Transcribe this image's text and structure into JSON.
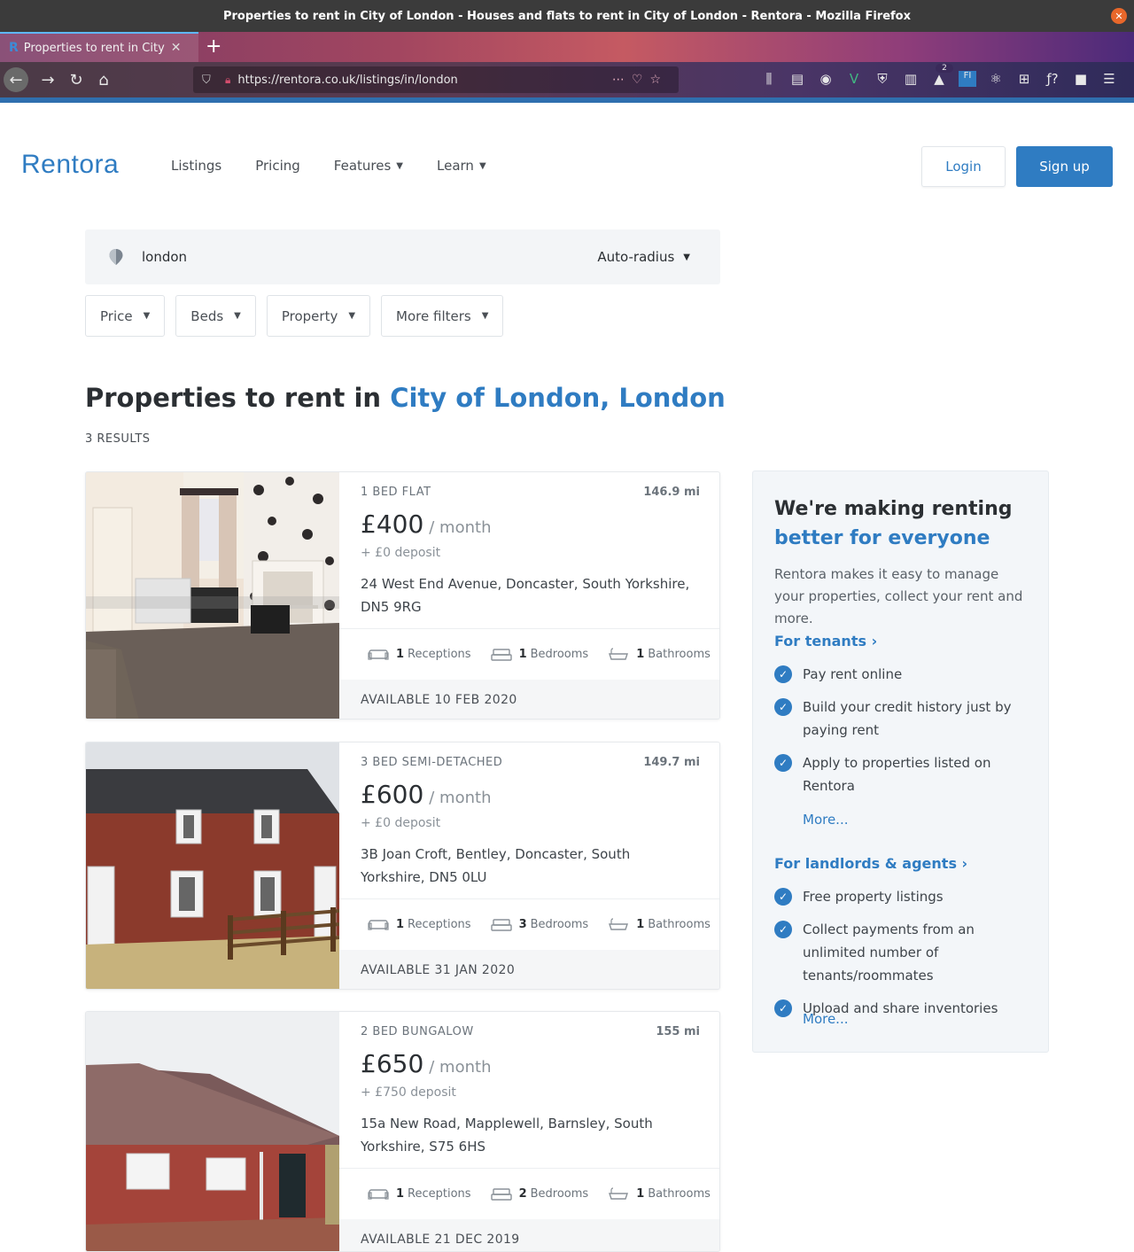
{
  "browser": {
    "window_title": "Properties to rent in City of London - Houses and flats to rent in City of London - Rentora - Mozilla Firefox",
    "tab_title": "Properties to rent in City of London",
    "url": "https://rentora.co.uk/listings/in/london",
    "notification_badge": "2"
  },
  "site": {
    "logo": "Rentora",
    "nav": [
      "Listings",
      "Pricing",
      "Features",
      "Learn"
    ],
    "login": "Login",
    "signup": "Sign up"
  },
  "search": {
    "query": "london",
    "radius": "Auto-radius",
    "filters": [
      "Price",
      "Beds",
      "Property",
      "More filters"
    ]
  },
  "heading": {
    "prefix": "Properties to rent in ",
    "place": "City of London, London",
    "results": "3 RESULTS"
  },
  "listings": [
    {
      "type": "1 BED FLAT",
      "distance": "146.9 mi",
      "price": "£400",
      "period": "/ month",
      "deposit": "+ £0 deposit",
      "address": "24 West End Avenue, Doncaster, South Yorkshire, DN5 9RG",
      "receptions": "1",
      "receptions_label": "Receptions",
      "bedrooms": "1",
      "bedrooms_label": "Bedrooms",
      "bathrooms": "1",
      "bathrooms_label": "Bathrooms",
      "available": "AVAILABLE 10 FEB 2020"
    },
    {
      "type": "3 BED SEMI-DETACHED",
      "distance": "149.7 mi",
      "price": "£600",
      "period": "/ month",
      "deposit": "+ £0 deposit",
      "address": "3B Joan Croft, Bentley, Doncaster, South Yorkshire, DN5 0LU",
      "receptions": "1",
      "receptions_label": "Receptions",
      "bedrooms": "3",
      "bedrooms_label": "Bedrooms",
      "bathrooms": "1",
      "bathrooms_label": "Bathrooms",
      "available": "AVAILABLE 31 JAN 2020"
    },
    {
      "type": "2 BED BUNGALOW",
      "distance": "155 mi",
      "price": "£650",
      "period": "/ month",
      "deposit": "+ £750 deposit",
      "address": "15a New Road, Mapplewell, Barnsley, South Yorkshire, S75 6HS",
      "receptions": "1",
      "receptions_label": "Receptions",
      "bedrooms": "2",
      "bedrooms_label": "Bedrooms",
      "bathrooms": "1",
      "bathrooms_label": "Bathrooms",
      "available": "AVAILABLE 21 DEC 2019"
    }
  ],
  "sidebar": {
    "title_line1": "We're making renting",
    "title_line2": "better for everyone",
    "intro": "Rentora makes it easy to manage your properties, collect your rent and more.",
    "tenants_heading": "For tenants",
    "tenants_items": [
      "Pay rent online",
      "Build your credit history just by paying rent",
      "Apply to properties listed on Rentora"
    ],
    "tenants_more": "More...",
    "landlords_heading": "For landlords & agents",
    "landlords_items": [
      "Free property listings",
      "Collect payments from an unlimited number of tenants/roommates",
      "Upload and share inventories"
    ],
    "landlords_more": "More..."
  }
}
